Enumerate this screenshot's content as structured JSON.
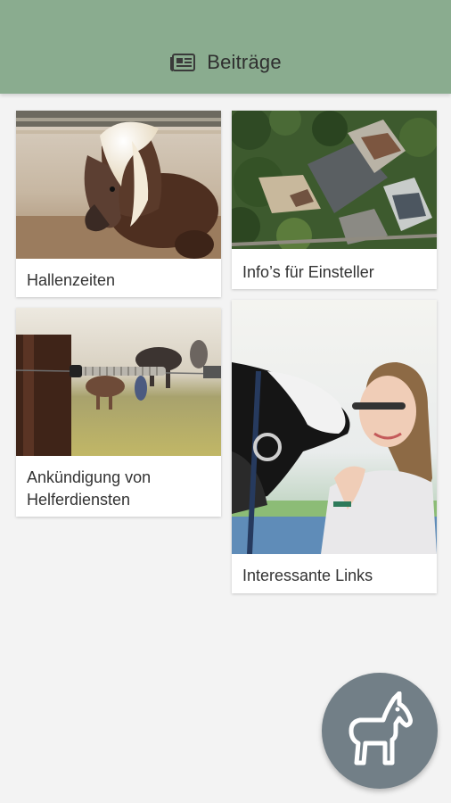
{
  "header": {
    "title": "Beiträge",
    "icon": "newspaper-icon",
    "color": "#8aac8f"
  },
  "cards": [
    {
      "label": "Hallenzeiten",
      "image": "pony-with-blond-mane-photo"
    },
    {
      "label": "Info’s für Einsteller",
      "image": "aerial-view-stable-photo"
    },
    {
      "label": "Ankündigung von Helferdiensten",
      "image": "electric-fence-horses-photo"
    },
    {
      "label": "Interessante Links",
      "image": "girl-kissing-horse-photo"
    }
  ],
  "fab": {
    "icon": "horse-icon",
    "color": "#727f87"
  }
}
